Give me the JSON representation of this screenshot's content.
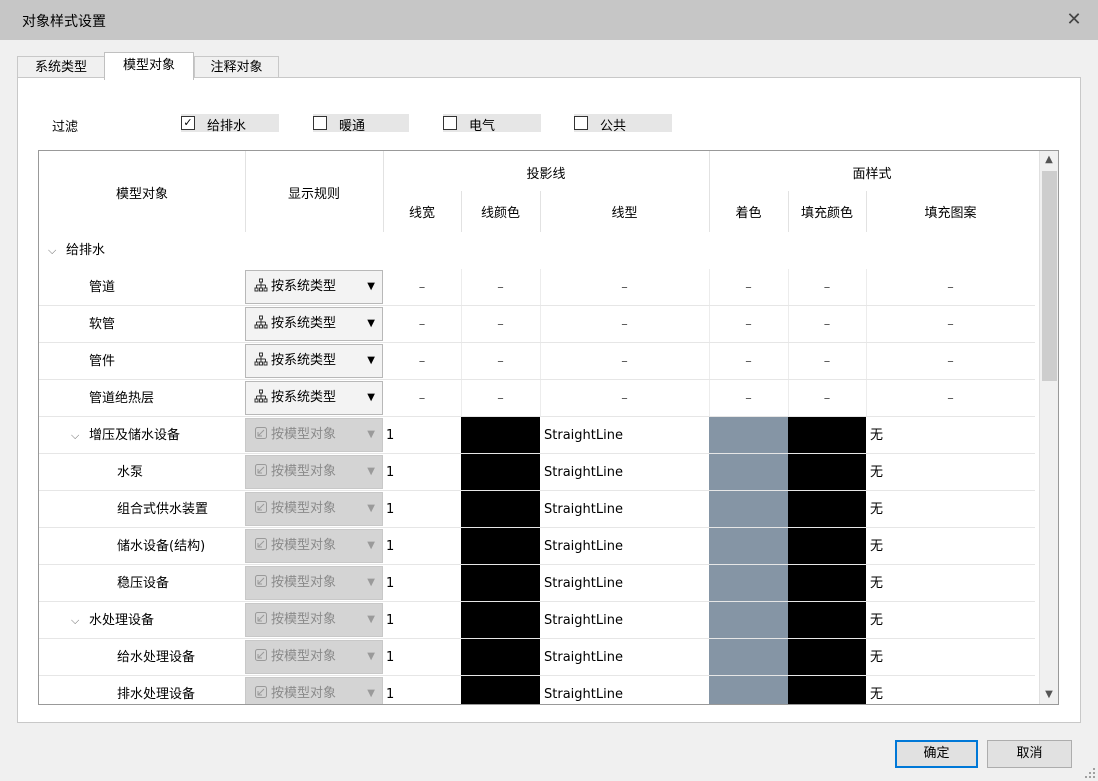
{
  "window": {
    "title": "对象样式设置",
    "close_glyph": "✕"
  },
  "tabs": [
    {
      "label": "系统类型",
      "active": false
    },
    {
      "label": "模型对象",
      "active": true
    },
    {
      "label": "注释对象",
      "active": false
    }
  ],
  "filter": {
    "label": "过滤",
    "options": [
      {
        "label": "给排水",
        "checked": true,
        "mark": "✓"
      },
      {
        "label": "暖通",
        "checked": false,
        "mark": ""
      },
      {
        "label": "电气",
        "checked": false,
        "mark": ""
      },
      {
        "label": "公共",
        "checked": false,
        "mark": ""
      }
    ]
  },
  "table": {
    "headers": {
      "model_object": "模型对象",
      "display_rule": "显示规则",
      "projection": "投影线",
      "line_width": "线宽",
      "line_color": "线颜色",
      "line_type": "线型",
      "face_style": "面样式",
      "shading": "着色",
      "fill_color": "填充颜色",
      "fill_pattern": "填充图案"
    },
    "group": {
      "label": "给排水",
      "chevron": "⌵"
    },
    "rows": [
      {
        "name": "管道",
        "level": 1,
        "rule": "按系统类型",
        "disabled": false,
        "width": "–",
        "line_type": "–",
        "pattern": "–"
      },
      {
        "name": "软管",
        "level": 1,
        "rule": "按系统类型",
        "disabled": false,
        "width": "–",
        "line_type": "–",
        "pattern": "–"
      },
      {
        "name": "管件",
        "level": 1,
        "rule": "按系统类型",
        "disabled": false,
        "width": "–",
        "line_type": "–",
        "pattern": "–"
      },
      {
        "name": "管道绝热层",
        "level": 1,
        "rule": "按系统类型",
        "disabled": false,
        "width": "–",
        "line_type": "–",
        "pattern": "–"
      },
      {
        "name": "增压及储水设备",
        "level": 1,
        "expand": "⌵",
        "rule": "按模型对象",
        "disabled": true,
        "width": "1",
        "line_type": "StraightLine",
        "pattern": "无"
      },
      {
        "name": "水泵",
        "level": 2,
        "rule": "按模型对象",
        "disabled": true,
        "width": "1",
        "line_type": "StraightLine",
        "pattern": "无"
      },
      {
        "name": "组合式供水装置",
        "level": 2,
        "rule": "按模型对象",
        "disabled": true,
        "width": "1",
        "line_type": "StraightLine",
        "pattern": "无"
      },
      {
        "name": "储水设备(结构)",
        "level": 2,
        "rule": "按模型对象",
        "disabled": true,
        "width": "1",
        "line_type": "StraightLine",
        "pattern": "无"
      },
      {
        "name": "稳压设备",
        "level": 2,
        "rule": "按模型对象",
        "disabled": true,
        "width": "1",
        "line_type": "StraightLine",
        "pattern": "无"
      },
      {
        "name": "水处理设备",
        "level": 1,
        "expand": "⌵",
        "rule": "按模型对象",
        "disabled": true,
        "width": "1",
        "line_type": "StraightLine",
        "pattern": "无"
      },
      {
        "name": "给水处理设备",
        "level": 2,
        "rule": "按模型对象",
        "disabled": true,
        "width": "1",
        "line_type": "StraightLine",
        "pattern": "无"
      },
      {
        "name": "排水处理设备",
        "level": 2,
        "rule": "按模型对象",
        "disabled": true,
        "width": "1",
        "line_type": "StraightLine",
        "pattern": "无"
      }
    ]
  },
  "colors": {
    "line_color": "#000000",
    "shading": "#8595a5",
    "fill_color": "#000000"
  },
  "buttons": {
    "ok": "确定",
    "cancel": "取消"
  },
  "icons": {
    "system_type": "hierarchy-icon",
    "model_object": "model-object-icon",
    "dropdown": "▼"
  }
}
